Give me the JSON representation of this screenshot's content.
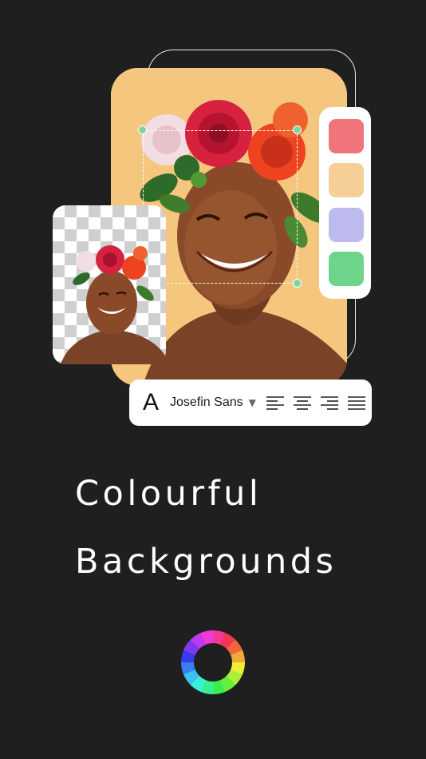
{
  "headline": {
    "line1": "Colourful",
    "line2": "Backgrounds"
  },
  "toolbar": {
    "font_glyph": "A",
    "font_name": "Josefin Sans",
    "caret": "▼",
    "align_icons": [
      "align-left-icon",
      "align-center-icon",
      "align-right-icon",
      "align-justify-icon"
    ]
  },
  "palette": {
    "swatches": [
      "#ef757a",
      "#f6cf96",
      "#bdbbee",
      "#6dd48a"
    ]
  },
  "colors": {
    "background": "#1f1f1f",
    "photo_background": "#f4c67e",
    "handle": "#7fd69a"
  },
  "icons": {
    "app_logo": "color-wheel-icon"
  }
}
